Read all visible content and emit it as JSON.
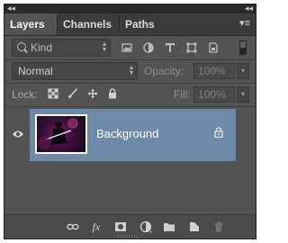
{
  "tabs": {
    "items": [
      {
        "label": "Layers",
        "active": true
      },
      {
        "label": "Channels",
        "active": false
      },
      {
        "label": "Paths",
        "active": false
      }
    ]
  },
  "titlebar": {
    "collapse_left": "◂◂",
    "collapse_right": "◂◂"
  },
  "filter": {
    "kind_label": "Kind"
  },
  "blending": {
    "mode": "Normal",
    "opacity_label": "Opacity:",
    "opacity_value": "100%"
  },
  "locks": {
    "lock_label": "Lock:",
    "fill_label": "Fill:",
    "fill_value": "100%"
  },
  "layers": [
    {
      "name": "Background",
      "visible": true,
      "locked": true,
      "selected": true
    }
  ],
  "colors": {
    "panel_bg": "#535353",
    "selected_row": "#6e8aa8",
    "tab_bar": "#3b3b3b"
  }
}
